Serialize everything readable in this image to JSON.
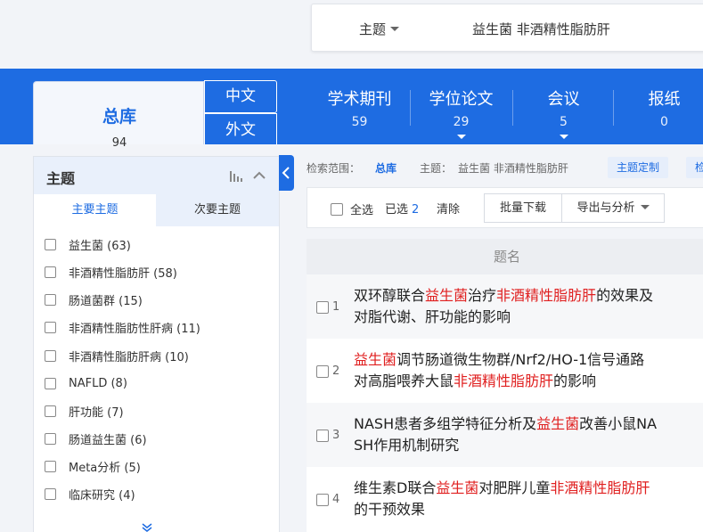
{
  "search": {
    "field": "主题",
    "query": "益生菌 非酒精性脂肪肝"
  },
  "db": {
    "all": {
      "label": "总库",
      "count": "94"
    },
    "lang": {
      "zh": "中文",
      "wai": "外文"
    },
    "tabs": [
      {
        "label": "学术期刊",
        "count": "59",
        "has_dropdown": false
      },
      {
        "label": "学位论文",
        "count": "29",
        "has_dropdown": true
      },
      {
        "label": "会议",
        "count": "5",
        "has_dropdown": true
      },
      {
        "label": "报纸",
        "count": "0",
        "has_dropdown": false
      }
    ]
  },
  "sidebar": {
    "title": "主题",
    "tabs": {
      "primary": "主要主题",
      "secondary": "次要主题"
    },
    "items": [
      "益生菌 (63)",
      "非酒精性脂肪肝 (58)",
      "肠道菌群 (15)",
      "非酒精性脂肪性肝病 (11)",
      "非酒精性脂肪肝病 (10)",
      "NAFLD (8)",
      "肝功能 (7)",
      "肠道益生菌 (6)",
      "Meta分析 (5)",
      "临床研究 (4)"
    ]
  },
  "scope": {
    "label": "检索范围：",
    "db": "总库",
    "topic_label": "主题：",
    "topic_value": "益生菌 非酒精性脂肪肝",
    "custom_btn": "主题定制",
    "next_btn": "检"
  },
  "toolbar": {
    "select_all": "全选",
    "selected_label": "已选",
    "selected_count": "2",
    "clear": "清除",
    "batch_download": "批量下载",
    "export": "导出与分析"
  },
  "results": {
    "header": "题名",
    "rows": [
      {
        "idx": "1",
        "line1": [
          [
            "双环醇联合",
            0
          ],
          [
            "益生菌",
            1
          ],
          [
            "治疗",
            0
          ],
          [
            "非酒精性脂肪肝",
            1
          ],
          [
            "的效果及",
            0
          ]
        ],
        "line2": [
          [
            "对脂代谢、肝功能的影响",
            0
          ]
        ]
      },
      {
        "idx": "2",
        "line1": [
          [
            "益生菌",
            1
          ],
          [
            "调节肠道微生物群/Nrf2/HO-1信号通路",
            0
          ]
        ],
        "line2": [
          [
            "对高脂喂养大鼠",
            0
          ],
          [
            "非酒精性脂肪肝",
            1
          ],
          [
            "的影响",
            0
          ]
        ]
      },
      {
        "idx": "3",
        "line1": [
          [
            "NASH患者多组学特征分析及",
            0
          ],
          [
            "益生菌",
            1
          ],
          [
            "改善小鼠NA",
            0
          ]
        ],
        "line2": [
          [
            "SH作用机制研究",
            0
          ]
        ]
      },
      {
        "idx": "4",
        "line1": [
          [
            "维生素D联合",
            0
          ],
          [
            "益生菌",
            1
          ],
          [
            "对肥胖儿童",
            0
          ],
          [
            "非酒精性脂肪肝",
            1
          ]
        ],
        "line2": [
          [
            "的干预效果",
            0
          ]
        ]
      }
    ]
  },
  "colors": {
    "accent": "#1e6ce2",
    "highlight": "#e02020"
  }
}
